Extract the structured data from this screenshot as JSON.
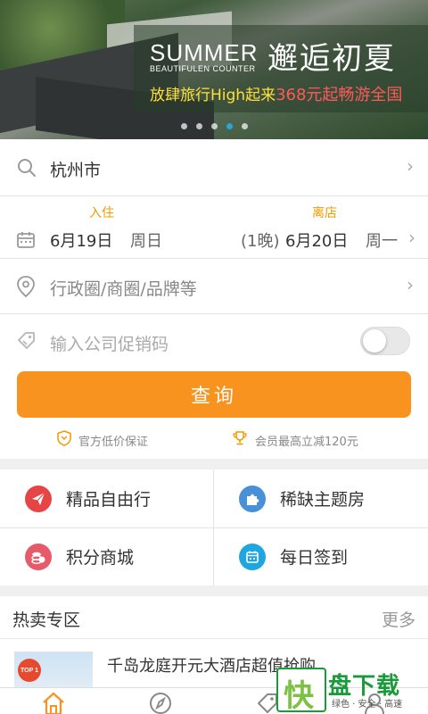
{
  "banner": {
    "headline_en": "SUMMER",
    "subline_en": "BEAUTIFULEN COUNTER",
    "headline_cn": "邂逅初夏",
    "promo_text": "放肆旅行High起来",
    "promo_price": "368元起畅游全国",
    "dot_count": 5,
    "active_dot": 3,
    "colors": {
      "promo_yellow": "#ffe03a",
      "promo_red": "#ff5a5a",
      "dot_active": "#2aa5d8"
    }
  },
  "search": {
    "city": "杭州市",
    "checkin_label": "入住",
    "checkin_date": "6月19日",
    "checkin_weekday": "周日",
    "checkout_label": "离店",
    "nights": "(1晚)",
    "checkout_date": "6月20日",
    "checkout_weekday": "周一",
    "area_placeholder": "行政圈/商圈/品牌等",
    "coupon_placeholder": "输入公司促销码",
    "coupon_toggle_on": false,
    "query_button": "查询",
    "guarantee_1": "官方低价保证",
    "guarantee_2": "会员最高立减120元",
    "icons": [
      "search-icon",
      "calendar-icon",
      "location-pin-icon",
      "tag-icon",
      "shield-icon",
      "trophy-icon"
    ],
    "colors": {
      "accent": "#f7931e",
      "label_orange": "#f39800"
    }
  },
  "grid": {
    "items": [
      {
        "label": "精品自由行",
        "icon": "paper-plane-icon",
        "color": "#e64545"
      },
      {
        "label": "稀缺主题房",
        "icon": "puzzle-icon",
        "color": "#4a90d9"
      },
      {
        "label": "积分商城",
        "icon": "coins-icon",
        "color": "#e85a6a"
      },
      {
        "label": "每日签到",
        "icon": "calendar-check-icon",
        "color": "#1fa6e0"
      }
    ]
  },
  "hot": {
    "title": "热卖专区",
    "more": "更多",
    "badge": "TOP 1",
    "item_title": "千岛龙庭开元大酒店超值抢购"
  },
  "tabbar": {
    "icons": [
      "home-icon",
      "compass-icon",
      "tag-icon",
      "user-icon"
    ],
    "active_color": "#f7931e"
  },
  "watermark": {
    "logo_char": "快",
    "name": "盘下载",
    "tagline": "绿色 · 安全 · 高速"
  }
}
